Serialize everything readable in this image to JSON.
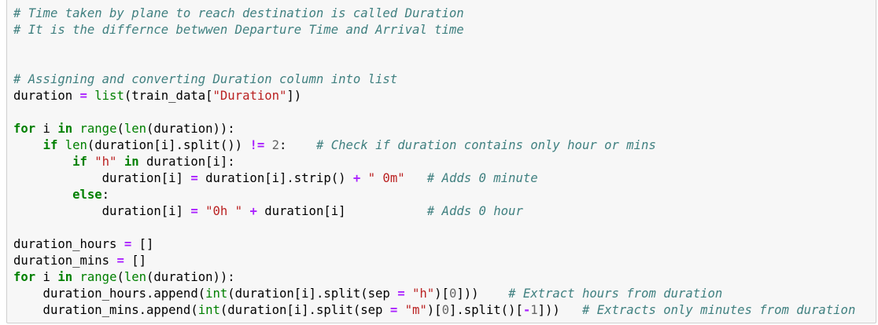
{
  "colors": {
    "background": "#f7f7f7",
    "border": "#cfcfcf",
    "comment": "#408080",
    "keyword": "#008000",
    "builtin": "#008000",
    "string": "#ba2121",
    "operator": "#aa22ff",
    "number": "#666666",
    "text": "#000000"
  },
  "lines": [
    [
      [
        "cm",
        "# Time taken by plane to reach destination is called Duration"
      ]
    ],
    [
      [
        "cm",
        "# It is the differnce betwwen Departure Time and Arrival time"
      ]
    ],
    [],
    [],
    [
      [
        "cm",
        "# Assigning and converting Duration column into list"
      ]
    ],
    [
      [
        "tx",
        "duration "
      ],
      [
        "op",
        "="
      ],
      [
        "tx",
        " "
      ],
      [
        "bi",
        "list"
      ],
      [
        "tx",
        "(train_data["
      ],
      [
        "st",
        "\"Duration\""
      ],
      [
        "tx",
        "])"
      ]
    ],
    [],
    [
      [
        "kw",
        "for"
      ],
      [
        "tx",
        " i "
      ],
      [
        "kw",
        "in"
      ],
      [
        "tx",
        " "
      ],
      [
        "bi",
        "range"
      ],
      [
        "tx",
        "("
      ],
      [
        "bi",
        "len"
      ],
      [
        "tx",
        "(duration)):"
      ]
    ],
    [
      [
        "tx",
        "    "
      ],
      [
        "kw",
        "if"
      ],
      [
        "tx",
        " "
      ],
      [
        "bi",
        "len"
      ],
      [
        "tx",
        "(duration[i].split()) "
      ],
      [
        "op",
        "!="
      ],
      [
        "tx",
        " "
      ],
      [
        "nu",
        "2"
      ],
      [
        "tx",
        ":    "
      ],
      [
        "cm",
        "# Check if duration contains only hour or mins"
      ]
    ],
    [
      [
        "tx",
        "        "
      ],
      [
        "kw",
        "if"
      ],
      [
        "tx",
        " "
      ],
      [
        "st",
        "\"h\""
      ],
      [
        "tx",
        " "
      ],
      [
        "kw",
        "in"
      ],
      [
        "tx",
        " duration[i]:"
      ]
    ],
    [
      [
        "tx",
        "            duration[i] "
      ],
      [
        "op",
        "="
      ],
      [
        "tx",
        " duration[i].strip() "
      ],
      [
        "op",
        "+"
      ],
      [
        "tx",
        " "
      ],
      [
        "st",
        "\" 0m\""
      ],
      [
        "tx",
        "   "
      ],
      [
        "cm",
        "# Adds 0 minute"
      ]
    ],
    [
      [
        "tx",
        "        "
      ],
      [
        "kw",
        "else"
      ],
      [
        "tx",
        ":"
      ]
    ],
    [
      [
        "tx",
        "            duration[i] "
      ],
      [
        "op",
        "="
      ],
      [
        "tx",
        " "
      ],
      [
        "st",
        "\"0h \""
      ],
      [
        "tx",
        " "
      ],
      [
        "op",
        "+"
      ],
      [
        "tx",
        " duration[i]           "
      ],
      [
        "cm",
        "# Adds 0 hour"
      ]
    ],
    [],
    [
      [
        "tx",
        "duration_hours "
      ],
      [
        "op",
        "="
      ],
      [
        "tx",
        " []"
      ]
    ],
    [
      [
        "tx",
        "duration_mins "
      ],
      [
        "op",
        "="
      ],
      [
        "tx",
        " []"
      ]
    ],
    [
      [
        "kw",
        "for"
      ],
      [
        "tx",
        " i "
      ],
      [
        "kw",
        "in"
      ],
      [
        "tx",
        " "
      ],
      [
        "bi",
        "range"
      ],
      [
        "tx",
        "("
      ],
      [
        "bi",
        "len"
      ],
      [
        "tx",
        "(duration)):"
      ]
    ],
    [
      [
        "tx",
        "    duration_hours.append("
      ],
      [
        "bi",
        "int"
      ],
      [
        "tx",
        "(duration[i].split(sep "
      ],
      [
        "op",
        "="
      ],
      [
        "tx",
        " "
      ],
      [
        "st",
        "\"h\""
      ],
      [
        "tx",
        ")["
      ],
      [
        "nu",
        "0"
      ],
      [
        "tx",
        "]))    "
      ],
      [
        "cm",
        "# Extract hours from duration"
      ]
    ],
    [
      [
        "tx",
        "    duration_mins.append("
      ],
      [
        "bi",
        "int"
      ],
      [
        "tx",
        "(duration[i].split(sep "
      ],
      [
        "op",
        "="
      ],
      [
        "tx",
        " "
      ],
      [
        "st",
        "\"m\""
      ],
      [
        "tx",
        ")["
      ],
      [
        "nu",
        "0"
      ],
      [
        "tx",
        "].split()["
      ],
      [
        "op",
        "-"
      ],
      [
        "nu",
        "1"
      ],
      [
        "tx",
        "]))   "
      ],
      [
        "cm",
        "# Extracts only minutes from duration"
      ]
    ]
  ]
}
